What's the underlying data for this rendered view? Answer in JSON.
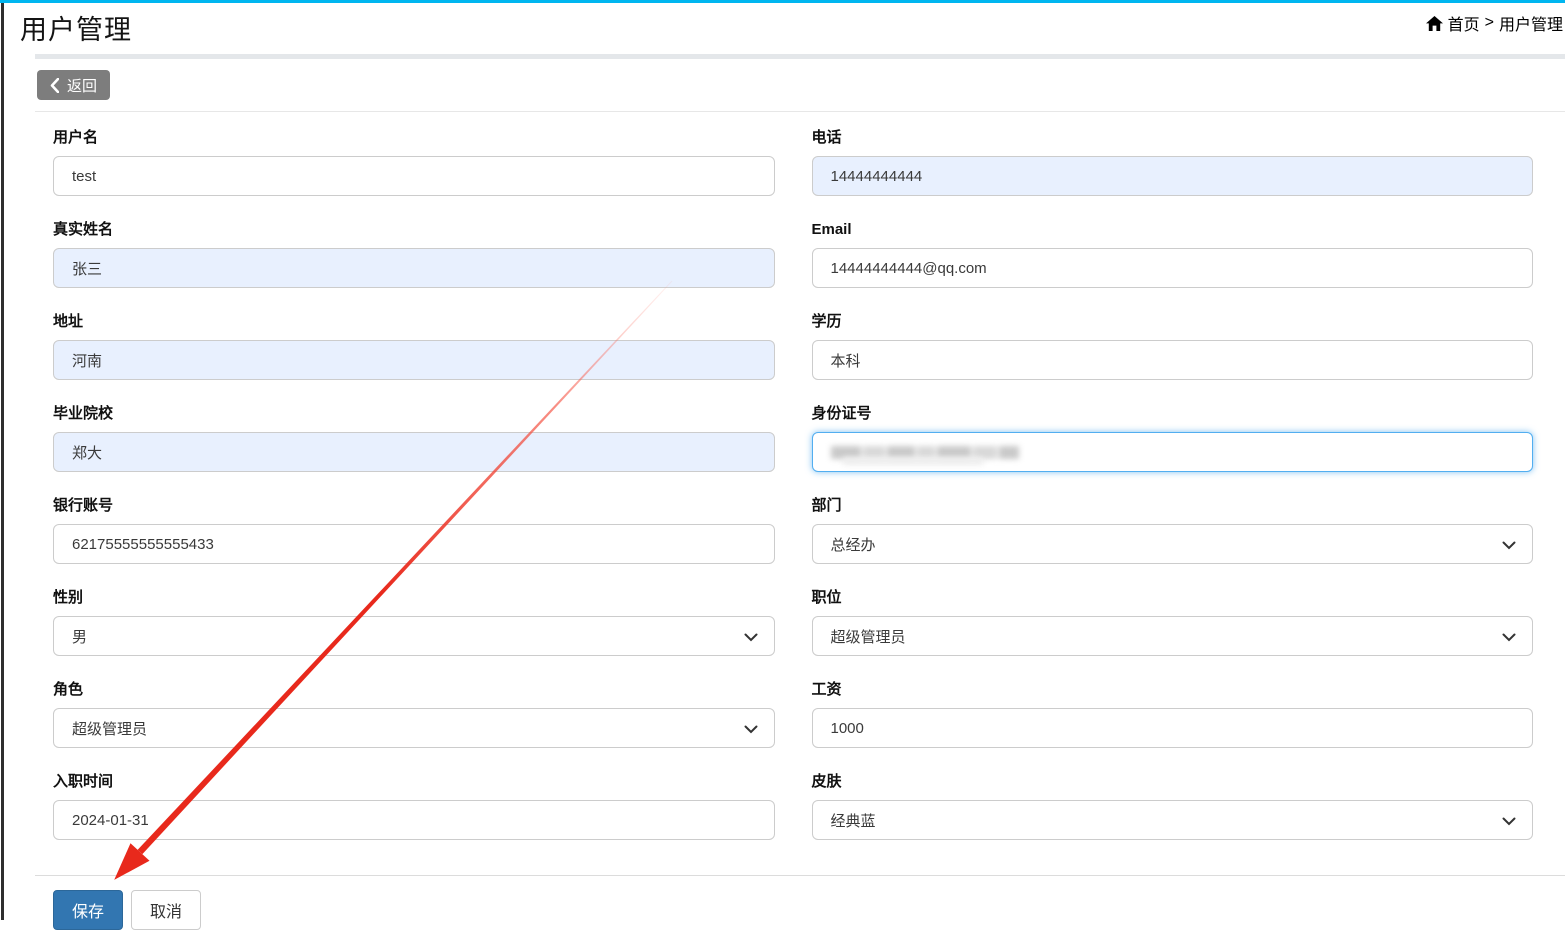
{
  "page": {
    "title": "用户管理",
    "breadcrumb": {
      "home": "首页",
      "separator": ">",
      "current": "用户管理"
    }
  },
  "toolbar": {
    "back_label": "返回"
  },
  "form": {
    "left": [
      {
        "label": "用户名",
        "value": "test",
        "type": "input",
        "variant": "default"
      },
      {
        "label": "真实姓名",
        "value": "张三",
        "type": "input",
        "variant": "autofill"
      },
      {
        "label": "地址",
        "value": "河南",
        "type": "input",
        "variant": "autofill"
      },
      {
        "label": "毕业院校",
        "value": "郑大",
        "type": "input",
        "variant": "autofill"
      },
      {
        "label": "银行账号",
        "value": "62175555555555433",
        "type": "input",
        "variant": "default"
      },
      {
        "label": "性别",
        "value": "男",
        "type": "select",
        "variant": "default"
      },
      {
        "label": "角色",
        "value": "超级管理员",
        "type": "select",
        "variant": "default"
      },
      {
        "label": "入职时间",
        "value": "2024-01-31",
        "type": "input",
        "variant": "default"
      }
    ],
    "right": [
      {
        "label": "电话",
        "value": "14444444444",
        "type": "input",
        "variant": "autofill"
      },
      {
        "label": "Email",
        "value": "14444444444@qq.com",
        "type": "input",
        "variant": "default"
      },
      {
        "label": "学历",
        "value": "本科",
        "type": "input",
        "variant": "default"
      },
      {
        "label": "身份证号",
        "value": "",
        "type": "input",
        "variant": "focused-redacted"
      },
      {
        "label": "部门",
        "value": "总经办",
        "type": "select",
        "variant": "default"
      },
      {
        "label": "职位",
        "value": "超级管理员",
        "type": "select",
        "variant": "default"
      },
      {
        "label": "工资",
        "value": "1000",
        "type": "input",
        "variant": "default"
      },
      {
        "label": "皮肤",
        "value": "经典蓝",
        "type": "select",
        "variant": "default"
      }
    ],
    "save_label": "保存",
    "cancel_label": "取消"
  },
  "colors": {
    "topbar_cyan": "#00b6f0",
    "sidebar_edge_dark": "#2f2f2f",
    "panel_top_band": "#e4e7ea",
    "back_button_gray": "#7d7d7d",
    "autofill_bg": "#e8f0fe",
    "focus_border": "#52aef0",
    "primary_button_blue": "#3276b1",
    "annotation_arrow_red": "#e8291c"
  }
}
